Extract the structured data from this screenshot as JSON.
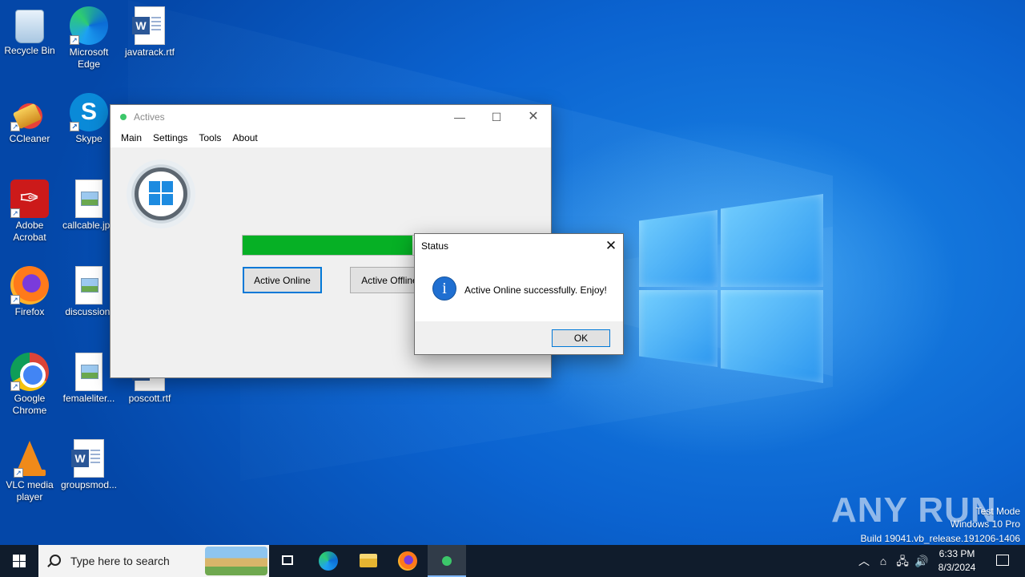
{
  "desktop": {
    "icons": [
      {
        "label": "Recycle Bin"
      },
      {
        "label": "Microsoft Edge"
      },
      {
        "label": "javatrack.rtf"
      },
      {
        "label": "CCleaner"
      },
      {
        "label": "Skype"
      },
      {
        "label": "Adobe Acrobat"
      },
      {
        "label": "callcable.jpg"
      },
      {
        "label": "Firefox"
      },
      {
        "label": "discussion."
      },
      {
        "label": "Google Chrome"
      },
      {
        "label": "femaleliter..."
      },
      {
        "label": "poscott.rtf"
      },
      {
        "label": "VLC media player"
      },
      {
        "label": "groupsmod..."
      }
    ]
  },
  "app_window": {
    "title": "Actives",
    "menu": [
      "Main",
      "Settings",
      "Tools",
      "About"
    ],
    "progress_fraction": 0.56,
    "progress_color": "#06b025",
    "buttons": {
      "online": "Active Online",
      "offline": "Active Offline"
    }
  },
  "dialog": {
    "title": "Status",
    "message": "Active Online successfully. Enjoy!",
    "ok_label": "OK",
    "icon": "info-icon"
  },
  "watermark": {
    "brand": "ANY RUN",
    "line1": "Test Mode",
    "line2": "Windows 10 Pro",
    "line3": "Build 19041.vb_release.191206-1406"
  },
  "taskbar": {
    "search_placeholder": "Type here to search",
    "time": "6:33 PM",
    "date": "8/3/2024"
  }
}
